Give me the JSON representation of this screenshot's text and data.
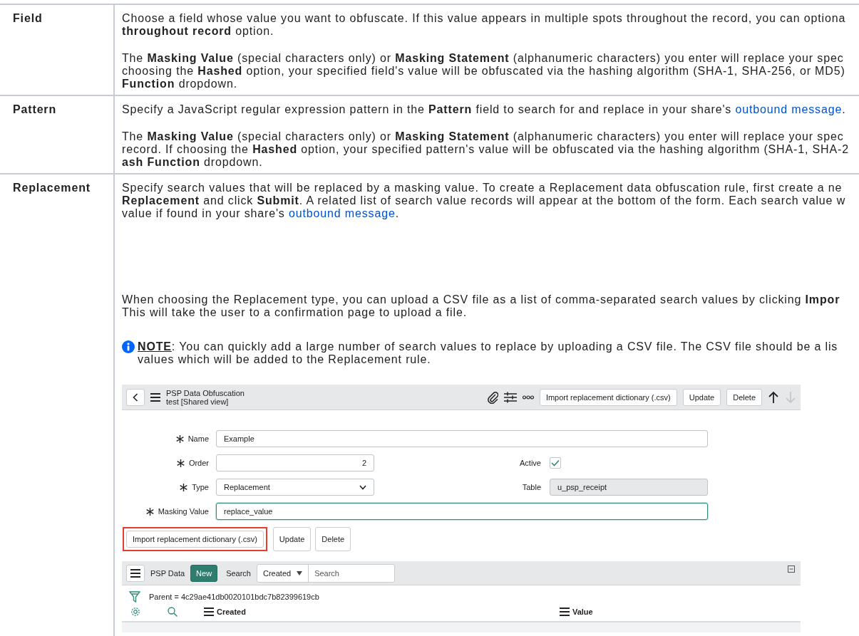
{
  "table": {
    "rows": [
      {
        "term": "Field",
        "paragraphs": [
          {
            "lines": [
              "Choose a field whose value you want to obfuscate. If this value appears in multiple spots throughout the record, you can optiona",
              "**throughout record** option."
            ]
          },
          {
            "lines": [
              "The **Masking Value** (special characters only) or **Masking Statement** (alphanumeric characters) you enter will replace your spec",
              "choosing the **Hashed** option, your specified field's value will be obfuscated via the hashing algorithm (SHA-1, SHA-256, or MD5)",
              "**Function** dropdown."
            ]
          }
        ]
      },
      {
        "term": "Pattern",
        "paragraphs": [
          {
            "lines": [
              {
                "text": "Specify a JavaScript regular expression pattern in the **Pattern** field to search for and replace in your share's ",
                "link": "outbound message",
                "after": "."
              }
            ]
          },
          {
            "lines": [
              "The **Masking Value** (special characters only) or **Masking Statement** (alphanumeric characters) you enter will replace your spec",
              "record. If choosing the **Hashed** option, your specified pattern's value will be obfuscated via the hashing algorithm (SHA-1, SHA-2",
              "**ash Function** dropdown."
            ]
          }
        ]
      },
      {
        "term": "Replacement",
        "paragraphs": [
          {
            "lines": [
              "Specify search values that will be replaced by a masking value. To create a Replacement data obfuscation rule, first create a ne",
              "**Replacement** and click **Submit**. A related list of search value records will appear at the bottom of the form. Each search value w",
              {
                "text": "value if found in your share's ",
                "link": "outbound message",
                "after": "."
              }
            ]
          },
          {
            "lines": [
              "When choosing the Replacement type, you can upload a CSV file as a list of comma-separated search values by clicking **Impor**",
              "This will take the user to a confirmation page to upload a file."
            ]
          }
        ],
        "note": {
          "label": "NOTE",
          "lines": [
            ": You can quickly add a large number of search values to replace by uploading a CSV file. The CSV file should be a lis",
            "values which will be added to the Replacement rule."
          ]
        },
        "screenshot": {
          "header": {
            "title": "PSP Data Obfuscation",
            "subtitle": "test [Shared view]",
            "buttons": [
              "Import replacement dictionary (.csv)",
              "Update",
              "Delete"
            ],
            "nav": [
              {
                "kind": "up",
                "disabled": false
              },
              {
                "kind": "down",
                "disabled": true
              }
            ]
          },
          "form_rows": [
            [
              {
                "label": "Name",
                "required": true,
                "kind": "text",
                "value": "Example",
                "focused": false
              }
            ],
            [
              {
                "label": "Order",
                "required": true,
                "kind": "number",
                "value": "2",
                "focused": false
              },
              {
                "label": "Active",
                "required": false,
                "kind": "checkbox",
                "checked": true
              }
            ],
            [
              {
                "label": "Type",
                "required": true,
                "kind": "select",
                "value": "Replacement"
              },
              {
                "label": "Table",
                "required": false,
                "kind": "readonly",
                "value": "u_psp_receipt"
              }
            ],
            [
              {
                "label": "Masking Value",
                "required": true,
                "kind": "text",
                "value": "replace_value",
                "focused": true
              }
            ]
          ],
          "buttons": [
            {
              "label": "Import replacement dictionary (.csv)",
              "highlighted": true
            },
            {
              "label": "Update",
              "highlighted": false
            },
            {
              "label": "Delete",
              "highlighted": false
            }
          ],
          "related_list": {
            "title": "PSP Data",
            "new_button": "New",
            "search_label": "Search",
            "search_field": "Created",
            "search_placeholder": "Search",
            "filter": "Parent = 4c29ae41db0020101bdc7b82399619cb",
            "columns": [
              "Created",
              "Value"
            ]
          }
        }
      }
    ]
  }
}
